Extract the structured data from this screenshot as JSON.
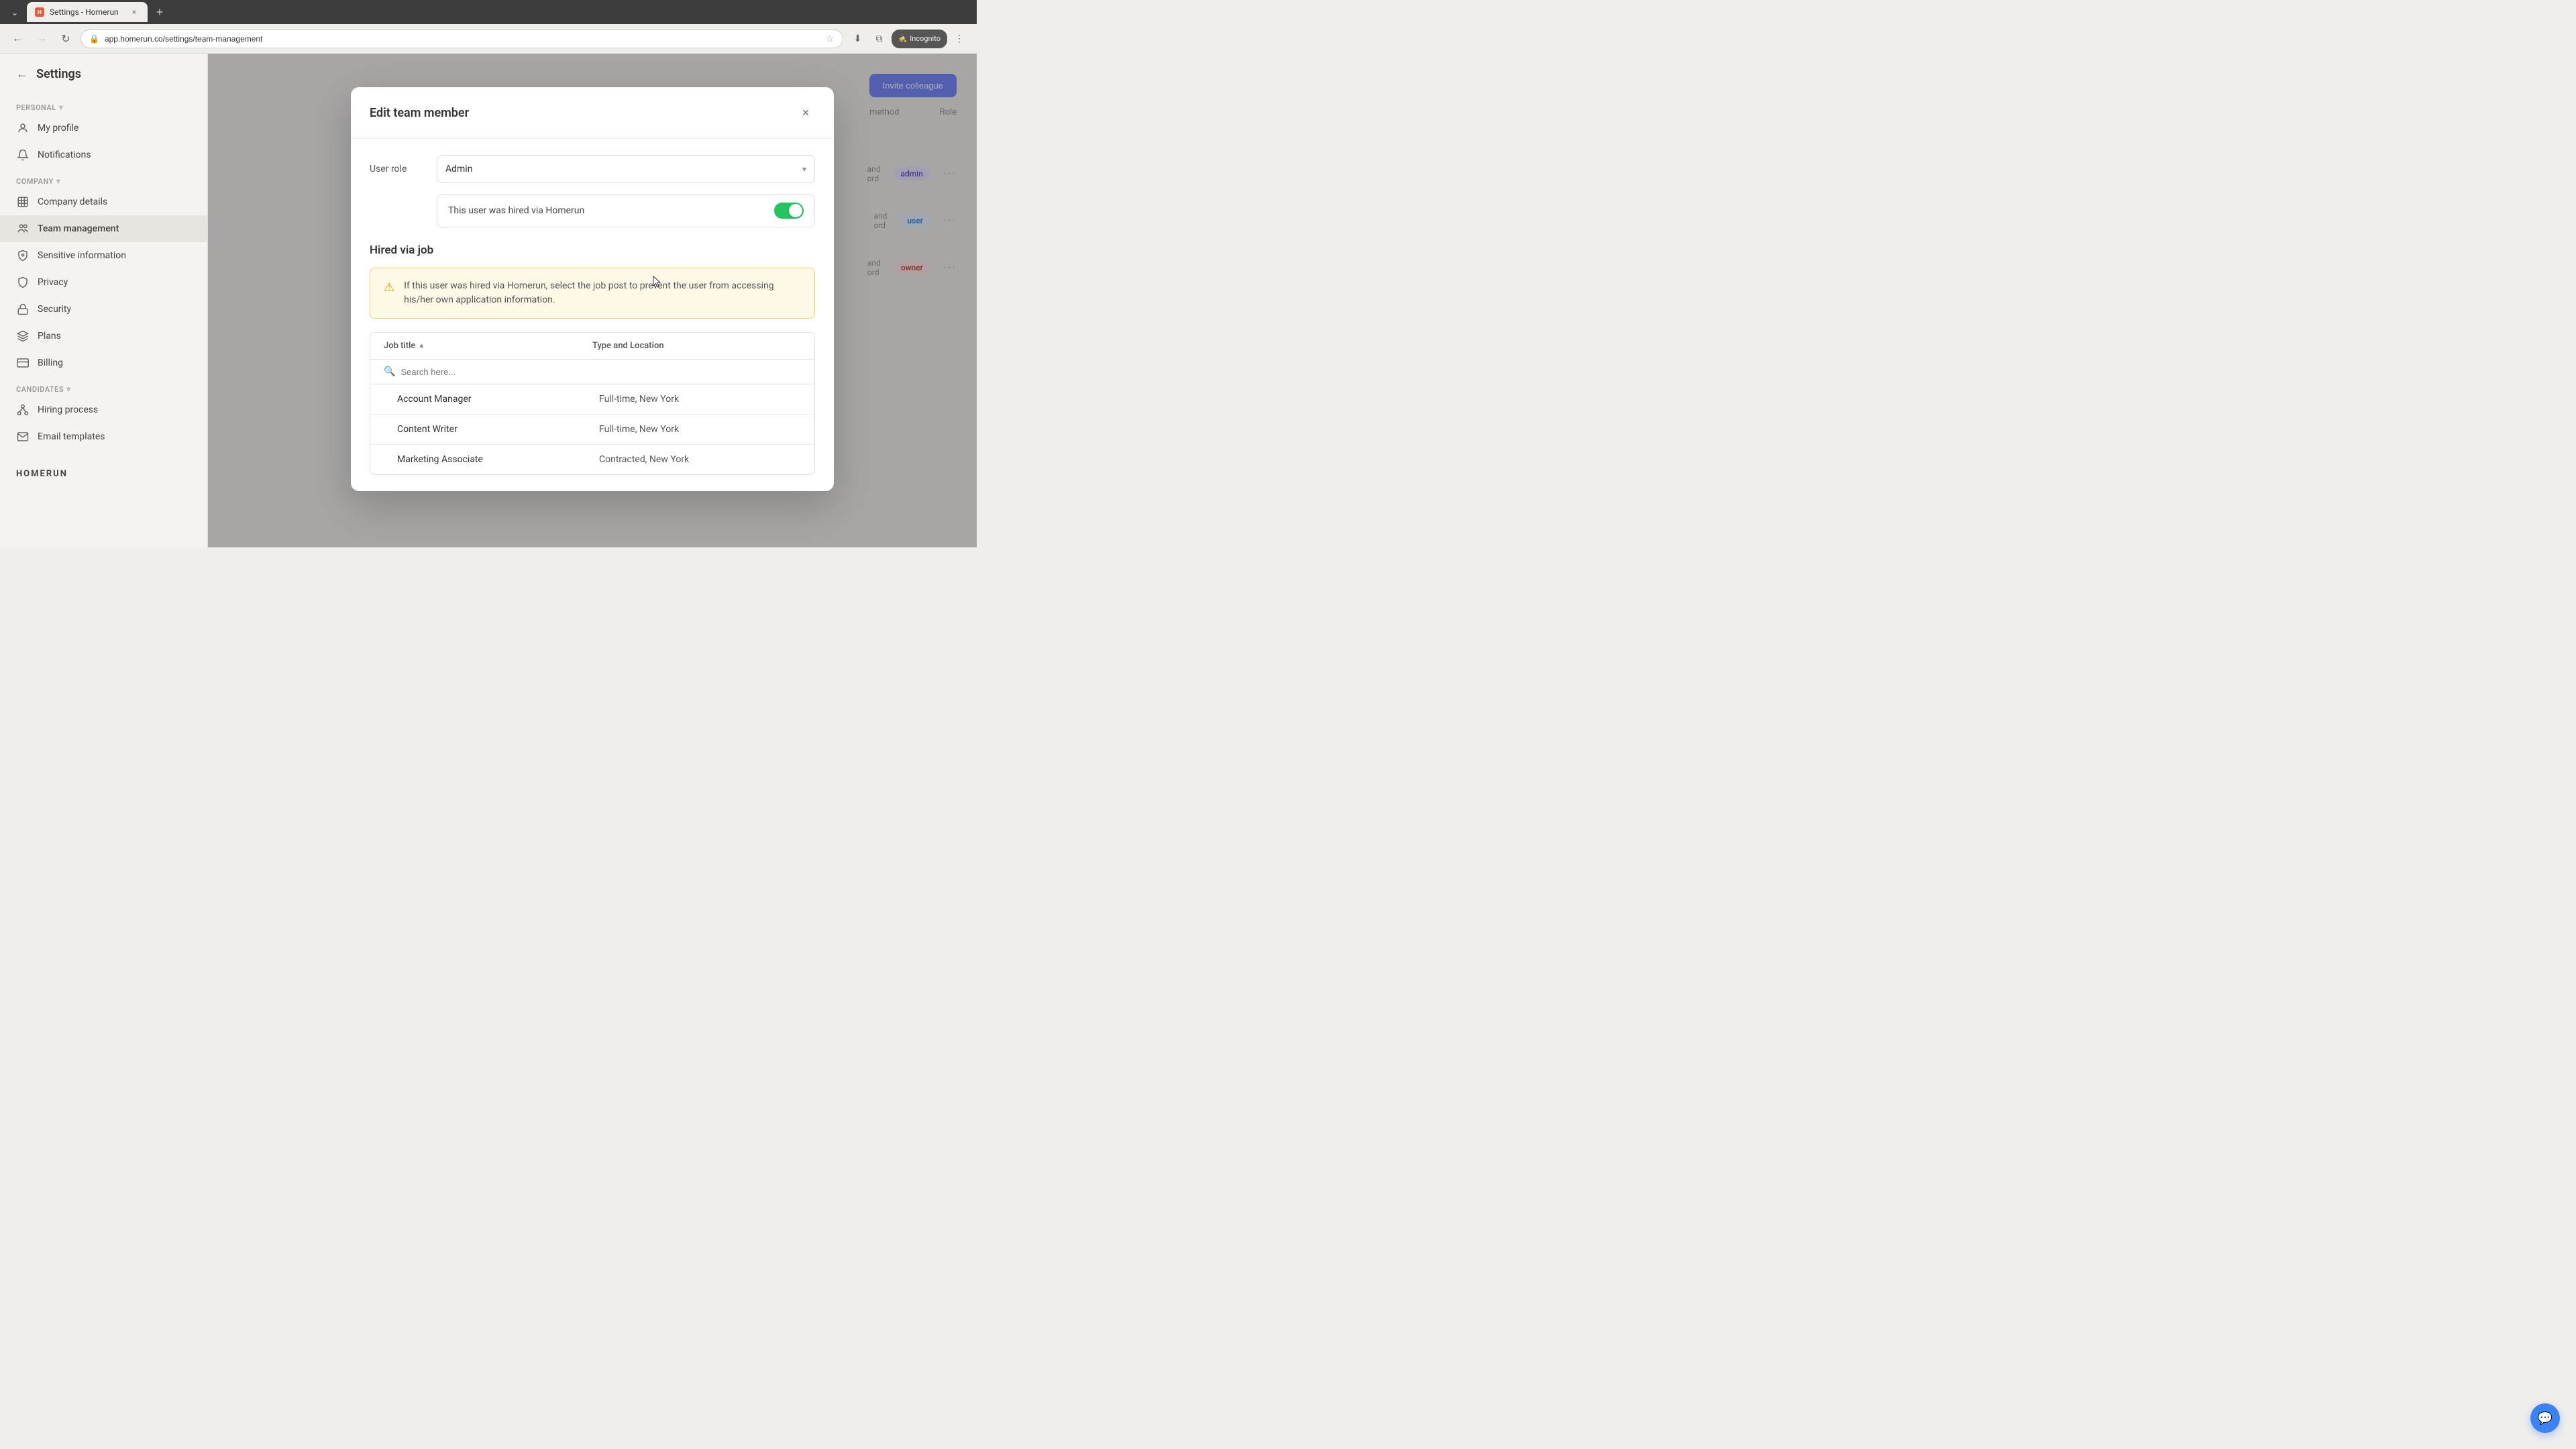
{
  "browser": {
    "tab_title": "Settings - Homerun",
    "url": "app.homerun.co/settings/team-management",
    "new_tab_label": "+",
    "incognito_label": "Incognito"
  },
  "sidebar": {
    "back_label": "←",
    "title": "Settings",
    "personal_section": "Personal",
    "items_personal": [
      {
        "id": "my-profile",
        "label": "My profile",
        "icon": "person"
      },
      {
        "id": "notifications",
        "label": "Notifications",
        "icon": "bell"
      }
    ],
    "company_section": "Company",
    "items_company": [
      {
        "id": "company-details",
        "label": "Company details",
        "icon": "building"
      },
      {
        "id": "team-management",
        "label": "Team management",
        "icon": "group",
        "active": true
      },
      {
        "id": "sensitive-information",
        "label": "Sensitive information",
        "icon": "shield-lock"
      },
      {
        "id": "privacy",
        "label": "Privacy",
        "icon": "shield"
      },
      {
        "id": "security",
        "label": "Security",
        "icon": "lock"
      },
      {
        "id": "plans",
        "label": "Plans",
        "icon": "layers"
      },
      {
        "id": "billing",
        "label": "Billing",
        "icon": "credit-card"
      }
    ],
    "candidates_section": "Candidates",
    "items_candidates": [
      {
        "id": "hiring-process",
        "label": "Hiring process",
        "icon": "flow"
      },
      {
        "id": "email-templates",
        "label": "Email templates",
        "icon": "mail"
      }
    ],
    "logo": "HOMERUN"
  },
  "bg": {
    "invite_btn": "Invite colleague",
    "col_method": "method",
    "col_role": "Role",
    "rows": [
      {
        "role": "admin",
        "badge_class": "role-admin"
      },
      {
        "role": "user",
        "badge_class": "role-user"
      },
      {
        "role": "owner",
        "badge_class": "role-owner"
      }
    ]
  },
  "modal": {
    "title": "Edit team member",
    "close_label": "×",
    "user_role_label": "User role",
    "role_value": "Admin",
    "toggle_label": "This user was hired via Homerun",
    "hired_section_title": "Hired via job",
    "warning_text": "If this user was hired via Homerun, select the job post to prevent the user from accessing his/her own application information.",
    "table": {
      "col_title": "Job title",
      "col_location": "Type and Location",
      "search_placeholder": "Search here...",
      "jobs": [
        {
          "title": "Account Manager",
          "location": "Full-time, New York"
        },
        {
          "title": "Content Writer",
          "location": "Full-time, New York"
        },
        {
          "title": "Marketing Associate",
          "location": "Contracted, New York"
        }
      ]
    }
  },
  "chat_button_icon": "💬"
}
